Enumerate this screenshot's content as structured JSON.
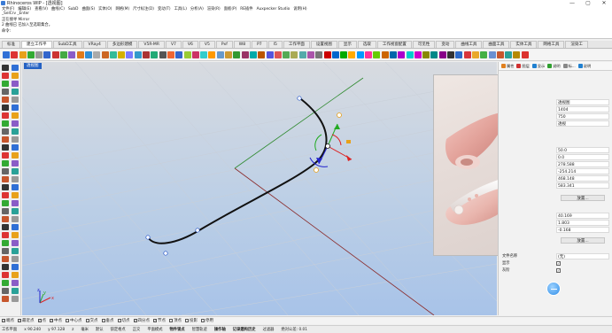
{
  "window": {
    "title": "Rhinoceros WIP - [透视图]",
    "buttons": [
      "—",
      "▢",
      "✕"
    ]
  },
  "menu": [
    "文件(F)",
    "编辑(E)",
    "查看(V)",
    "曲线(C)",
    "SubD",
    "曲面(S)",
    "实体(O)",
    "网格(M)",
    "尺寸标注(D)",
    "变动(T)",
    "工具(L)",
    "分析(A)",
    "渲染(R)",
    "面板(P)",
    "RE插件",
    "Auxpecker Studio",
    "说明(H)"
  ],
  "command_history": [
    "_SelCrv _Enter",
    "正在搜寻 Mirror",
    "2 曲线已 已加入至选取集合。",
    "",
    "命令:"
  ],
  "tabs": [
    "标准",
    "建立工作平",
    "SubD工具",
    "VRay4",
    "多边形建模",
    "V5R-MR",
    "V7",
    "V6",
    "V5",
    "Pxf",
    "W8",
    "P7",
    "I5",
    "工作平面",
    "设置视图",
    "显示",
    "选取",
    "工作视窗配置",
    "可见性",
    "变动",
    "曲线工具",
    "曲面工具",
    "实体工具",
    "网格工具",
    "渲染工"
  ],
  "active_tab_index": 1,
  "toolbar_icon_colors": [
    "#2f6fd6",
    "#d33",
    "#e8a11a",
    "#3a3",
    "#999",
    "#3366cc",
    "#cc3333",
    "#44aa44",
    "#8a5cc7",
    "#e07b1a",
    "#2f8fd6",
    "#aaa",
    "#c62",
    "#3b9",
    "#d4b000",
    "#7a7aff",
    "#39c",
    "#a33",
    "#2a7",
    "#555",
    "#e63",
    "#36c",
    "#9c3",
    "#c36",
    "#3cc",
    "#f90",
    "#69c",
    "#c93",
    "#393",
    "#936",
    "#0aa",
    "#b50",
    "#55d",
    "#d55",
    "#5a5",
    "#aa5",
    "#5aa",
    "#a5a",
    "#777",
    "#c00",
    "#06c",
    "#0a0",
    "#fa0",
    "#09f",
    "#f39",
    "#6c0",
    "#c60",
    "#06a",
    "#a0c",
    "#0cc",
    "#c0c",
    "#880",
    "#088",
    "#808",
    "#333",
    "#2d6ac9",
    "#d8363c",
    "#e9a82a",
    "#44b044",
    "#6a8fd0",
    "#c6562d",
    "#2aa198",
    "#b58900",
    "#dc322f"
  ],
  "viewport": {
    "label": "透视图",
    "axis_labels": {
      "x": "x",
      "y": "y",
      "z": "z"
    }
  },
  "panel": {
    "tabs": [
      {
        "label": "属性",
        "color": "#e08020"
      },
      {
        "label": "图层",
        "color": "#d03030"
      },
      {
        "label": "显示",
        "color": "#2080d0"
      },
      {
        "label": "说明",
        "color": "#30a030"
      },
      {
        "label": "标...",
        "color": "#888888"
      },
      {
        "label": "说明",
        "color": "#2080d0"
      }
    ],
    "rows": [
      {
        "label": "",
        "value": "透视图"
      },
      {
        "label": "",
        "value": "1404"
      },
      {
        "label": "",
        "value": "750"
      },
      {
        "label": "",
        "value": "透视"
      },
      {
        "label": "",
        "value": "50.0"
      },
      {
        "label": "",
        "value": "0.0"
      },
      {
        "label": "",
        "value": "278.588"
      },
      {
        "label": "",
        "value": "-254.214"
      },
      {
        "label": "",
        "value": "468.148"
      },
      {
        "label": "",
        "value": "583.341"
      },
      {
        "label": "",
        "value": "40.169"
      },
      {
        "label": "",
        "value": "1.803"
      },
      {
        "label": "",
        "value": "-0.168"
      },
      {
        "label": "文件名称",
        "value": "(无)"
      },
      {
        "label": "显示",
        "value": ""
      },
      {
        "label": "灰阶",
        "value": ""
      }
    ],
    "place_button": "放置...",
    "place_button2": "放置..."
  },
  "osnaps": [
    {
      "label": "端点",
      "checked": true
    },
    {
      "label": "最近点",
      "checked": true
    },
    {
      "label": "点",
      "checked": true
    },
    {
      "label": "中点",
      "checked": true
    },
    {
      "label": "中心点",
      "checked": false
    },
    {
      "label": "交点",
      "checked": false
    },
    {
      "label": "垂点",
      "checked": false
    },
    {
      "label": "切点",
      "checked": false
    },
    {
      "label": "四分点",
      "checked": true
    },
    {
      "label": "节点",
      "checked": true
    },
    {
      "label": "顶点",
      "checked": false
    },
    {
      "label": "投影",
      "checked": false
    },
    {
      "label": "停用",
      "checked": false
    }
  ],
  "status": {
    "cplane": "工作平面",
    "x": "x 90.240",
    "y": "y 97.128",
    "z": "z",
    "unit": "毫米",
    "layer": "默认",
    "grid_snap": "锁定格点",
    "ortho": "正交",
    "planar": "平面模式",
    "osnap": "物件锁点",
    "smarttrack": "智慧轨迹",
    "gumball": "操作轴",
    "history": "记录建构历史",
    "filter": "过滤器",
    "tolerance": "绝对公差: 0.01"
  }
}
